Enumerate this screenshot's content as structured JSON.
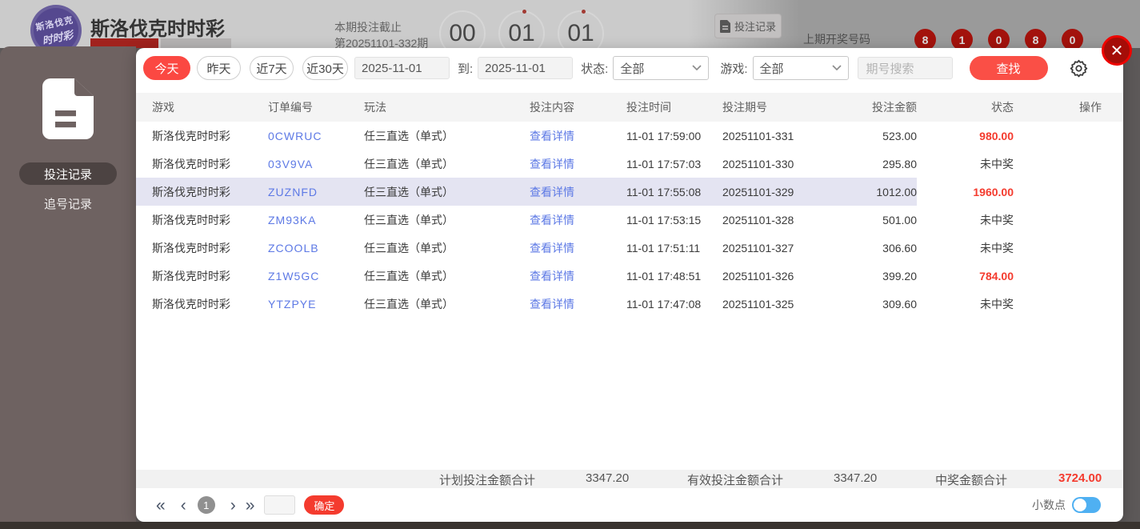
{
  "page": {
    "title": "斯洛伐克时时彩",
    "logo_line1": "斯洛伐克",
    "logo_line2": "时时彩",
    "deadline_label": "本期投注截止",
    "deadline_period": "第20251101-332期",
    "countdown": [
      "00",
      "01",
      "01"
    ],
    "bet_record_button": "投注记录",
    "last_draw_label": "上期开奖号码",
    "last_draw_numbers": [
      "8",
      "1",
      "0",
      "8",
      "0"
    ]
  },
  "sidebar": {
    "items": [
      {
        "label": "投注记录",
        "active": true
      },
      {
        "label": "追号记录",
        "active": false
      }
    ]
  },
  "modal": {
    "filters": {
      "quick": [
        "今天",
        "昨天",
        "近7天",
        "近30天"
      ],
      "date_from": "2025-11-01",
      "to_label": "到:",
      "date_to": "2025-11-01",
      "status_label": "状态:",
      "status_value": "全部",
      "game_label": "游戏:",
      "game_value": "全部",
      "search_placeholder": "期号搜索",
      "search_button": "查找"
    },
    "table": {
      "headers": [
        "游戏",
        "订单编号",
        "玩法",
        "投注内容",
        "投注时间",
        "投注期号",
        "投注金额",
        "状态",
        "操作"
      ],
      "rows": [
        {
          "game": "斯洛伐克时时彩",
          "order": "0CWRUC",
          "play": "任三直选（单式）",
          "content": "查看详情",
          "time": "11-01 17:59:00",
          "period": "20251101-331",
          "amount": "523.00",
          "status": "980.00",
          "win": true,
          "highlight": false
        },
        {
          "game": "斯洛伐克时时彩",
          "order": "03V9VA",
          "play": "任三直选（单式）",
          "content": "查看详情",
          "time": "11-01 17:57:03",
          "period": "20251101-330",
          "amount": "295.80",
          "status": "未中奖",
          "win": false,
          "highlight": false
        },
        {
          "game": "斯洛伐克时时彩",
          "order": "ZUZNFD",
          "play": "任三直选（单式）",
          "content": "查看详情",
          "time": "11-01 17:55:08",
          "period": "20251101-329",
          "amount": "1012.00",
          "status": "1960.00",
          "win": true,
          "highlight": true
        },
        {
          "game": "斯洛伐克时时彩",
          "order": "ZM93KA",
          "play": "任三直选（单式）",
          "content": "查看详情",
          "time": "11-01 17:53:15",
          "period": "20251101-328",
          "amount": "501.00",
          "status": "未中奖",
          "win": false,
          "highlight": false
        },
        {
          "game": "斯洛伐克时时彩",
          "order": "ZCOOLB",
          "play": "任三直选（单式）",
          "content": "查看详情",
          "time": "11-01 17:51:11",
          "period": "20251101-327",
          "amount": "306.60",
          "status": "未中奖",
          "win": false,
          "highlight": false
        },
        {
          "game": "斯洛伐克时时彩",
          "order": "Z1W5GC",
          "play": "任三直选（单式）",
          "content": "查看详情",
          "time": "11-01 17:48:51",
          "period": "20251101-326",
          "amount": "399.20",
          "status": "784.00",
          "win": true,
          "highlight": false
        },
        {
          "game": "斯洛伐克时时彩",
          "order": "YTZPYE",
          "play": "任三直选（单式）",
          "content": "查看详情",
          "time": "11-01 17:47:08",
          "period": "20251101-325",
          "amount": "309.60",
          "status": "未中奖",
          "win": false,
          "highlight": false
        }
      ]
    },
    "summary": {
      "planned_label": "计划投注金额合计",
      "planned_value": "3347.20",
      "valid_label": "有效投注金额合计",
      "valid_value": "3347.20",
      "win_label": "中奖金额合计",
      "win_value": "3724.00"
    },
    "pagination": {
      "current_page": "1",
      "confirm_button": "确定",
      "decimal_label": "小数点"
    },
    "close_icon": "✕"
  },
  "colors": {
    "accent_red": "#fa4f46",
    "link_blue": "#5d79e5",
    "win_red": "#f43b2e",
    "toggle_blue": "#4fb0f2",
    "highlight_row": "#e4e4f2"
  }
}
